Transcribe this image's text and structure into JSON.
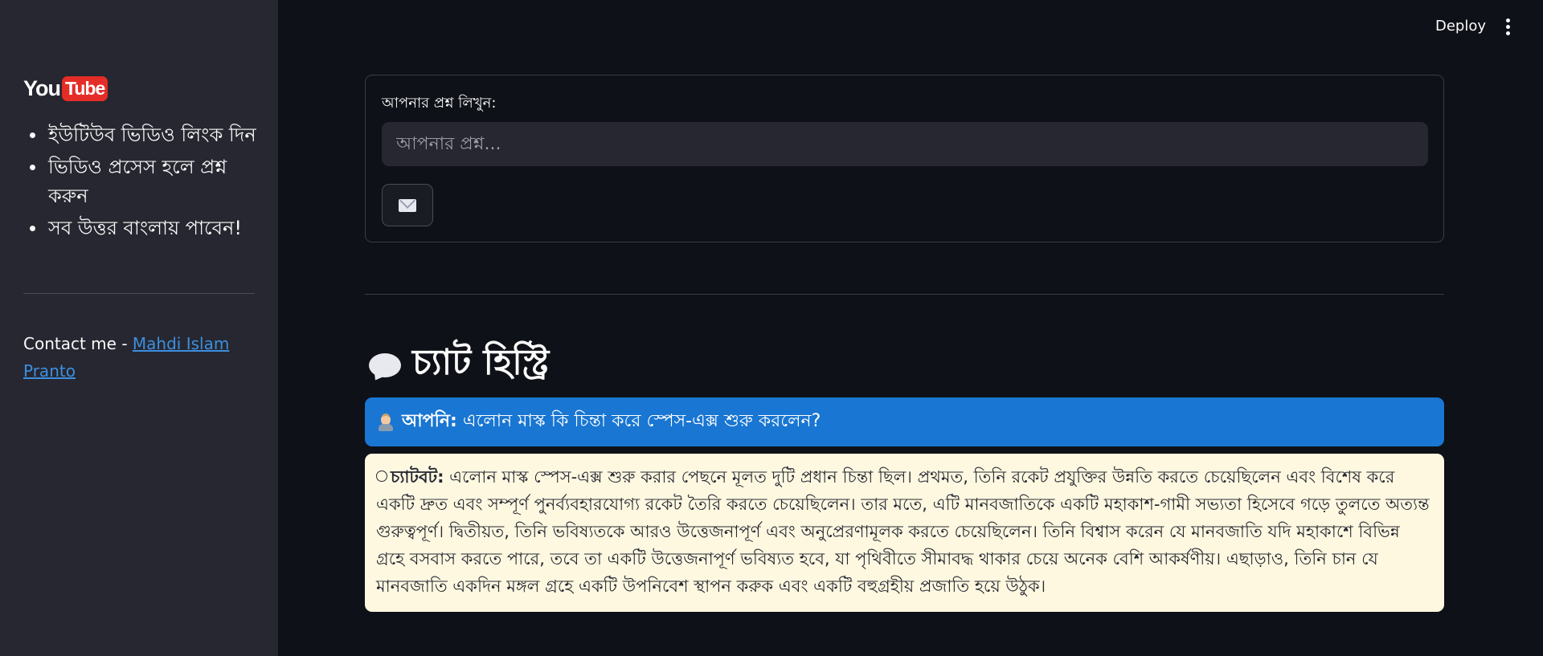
{
  "sidebar": {
    "logo": {
      "you": "You",
      "tube": "Tube"
    },
    "items": [
      "ইউটিউব ভিডিও লিংক দিন",
      "ভিডিও প্রসেস হলে প্রশ্ন করুন",
      "সব উত্তর বাংলায় পাবেন!"
    ],
    "contact_prefix": "Contact me - ",
    "contact_name": "Mahdi Islam Pranto"
  },
  "header": {
    "deploy_label": "Deploy",
    "menu_icon": "vertical-dots-icon"
  },
  "form": {
    "label": "আপনার প্রশ্ন লিখুন:",
    "input_value": "",
    "input_placeholder": "আপনার প্রশ্ন...",
    "submit_icon": "envelope-icon"
  },
  "chat": {
    "heading_icon": "speech-bubble-icon",
    "heading": "চ্যাট হিস্ট্রি",
    "messages": [
      {
        "role": "user",
        "icon": "user-avatar-icon",
        "label": "আপনি:",
        "text": "এলোন মাস্ক কি চিন্তা করে স্পেস-এক্স শুরু করলেন?",
        "color": "#1976d2"
      },
      {
        "role": "bot",
        "icon": "bot-face-icon",
        "label": "চ্যাটবট:",
        "text": "এলোন মাস্ক স্পেস-এক্স শুরু করার পেছনে মূলত দুটি প্রধান চিন্তা ছিল। প্রথমত, তিনি রকেট প্রযুক্তির উন্নতি করতে চেয়েছিলেন এবং বিশেষ করে একটি দ্রুত এবং সম্পূর্ণ পুনর্ব্যবহারযোগ্য রকেট তৈরি করতে চেয়েছিলেন। তার মতে, এটি মানবজাতিকে একটি মহাকাশ-গামী সভ্যতা হিসেবে গড়ে তুলতে অত্যন্ত গুরুত্বপূর্ণ। দ্বিতীয়ত, তিনি ভবিষ্যতকে আরও উত্তেজনাপূর্ণ এবং অনুপ্রেরণামূলক করতে চেয়েছিলেন। তিনি বিশ্বাস করেন যে মানবজাতি যদি মহাকাশে বিভিন্ন গ্রহে বসবাস করতে পারে, তবে তা একটি উত্তেজনাপূর্ণ ভবিষ্যত হবে, যা পৃথিবীতে সীমাবদ্ধ থাকার চেয়ে অনেক বেশি আকর্ষণীয়। এছাড়াও, তিনি চান যে মানবজাতি একদিন মঙ্গল গ্রহে একটি উপনিবেশ স্থাপন করুক এবং একটি বহুগ্রহীয় প্রজাতি হয়ে উঠুক।",
        "color": "#fef8e1"
      }
    ]
  },
  "colors": {
    "background": "#0e1117",
    "sidebar": "#262730",
    "link": "#3d8fe0",
    "user_message": "#1976d2",
    "bot_message": "#fef8e1"
  }
}
